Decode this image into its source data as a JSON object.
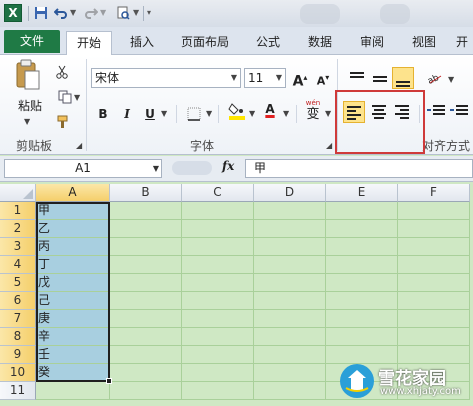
{
  "title_bar": {
    "app_icon_letter": "X"
  },
  "tabs": [
    {
      "label": "文件"
    },
    {
      "label": "开始"
    },
    {
      "label": "插入"
    },
    {
      "label": "页面布局"
    },
    {
      "label": "公式"
    },
    {
      "label": "数据"
    },
    {
      "label": "审阅"
    },
    {
      "label": "视图"
    },
    {
      "label": "开"
    }
  ],
  "ribbon": {
    "clipboard": {
      "paste_label": "粘贴",
      "group_label": "剪贴板"
    },
    "font": {
      "font_name": "宋体",
      "font_size": "11",
      "bold": "B",
      "italic": "I",
      "underline": "U",
      "font_color_letter": "A",
      "phonetic_label": "wén",
      "phonetic_char": "变",
      "group_label": "字体"
    },
    "alignment": {
      "group_label": "对齐方式"
    }
  },
  "formula_bar": {
    "name_box": "A1",
    "fx_label": "fx",
    "content": "甲"
  },
  "sheet": {
    "columns": [
      "A",
      "B",
      "C",
      "D",
      "E",
      "F"
    ],
    "rows": [
      "1",
      "2",
      "3",
      "4",
      "5",
      "6",
      "7",
      "8",
      "9",
      "10",
      "11"
    ],
    "column_a_values": [
      "甲",
      "乙",
      "丙",
      "丁",
      "戊",
      "己",
      "庚",
      "辛",
      "壬",
      "癸"
    ]
  },
  "watermark": {
    "title": "雪花家园",
    "url": "www.xhjaty.com"
  },
  "colors": {
    "file_tab": "#1f7a45",
    "grid_background": "#cfe8c4",
    "selected_cells": "#a8cfe0",
    "highlight_box": "#cf3a3a",
    "font_color_bar": "#e02020",
    "fill_color_bar": "#ffe600"
  }
}
